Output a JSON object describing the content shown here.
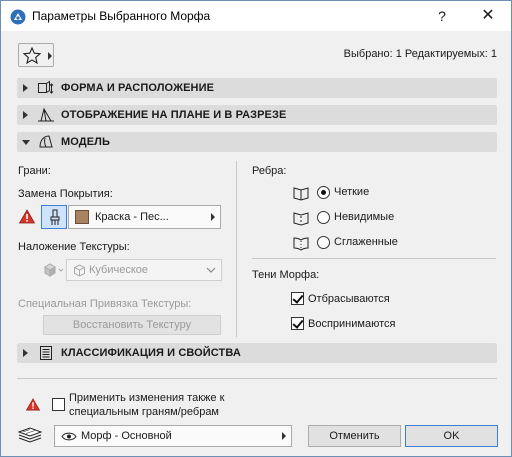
{
  "window": {
    "title": "Параметры Выбранного Морфа",
    "help": "?",
    "close": "✕"
  },
  "toolbar": {
    "selection_info": "Выбрано: 1 Редактируемых: 1"
  },
  "panels": [
    {
      "label": "ФОРМА И РАСПОЛОЖЕНИЕ",
      "expanded": false
    },
    {
      "label": "ОТОБРАЖЕНИЕ НА ПЛАНЕ И В РАЗРЕЗЕ",
      "expanded": false
    },
    {
      "label": "МОДЕЛЬ",
      "expanded": true
    },
    {
      "label": "КЛАССИФИКАЦИЯ И СВОЙСТВА",
      "expanded": false
    }
  ],
  "model": {
    "faces_label": "Грани:",
    "surface_override_label": "Замена Покрытия:",
    "surface_value": "Краска - Пес...",
    "texture_mapping_label": "Наложение Текстуры:",
    "texture_mapping_value": "Кубическое",
    "custom_texture_label": "Специальная Привязка Текстуры:",
    "restore_texture_button": "Восстановить Текстуру",
    "edges_label": "Ребра:",
    "edge_options": [
      {
        "label": "Четкие",
        "selected": true
      },
      {
        "label": "Невидимые",
        "selected": false
      },
      {
        "label": "Сглаженные",
        "selected": false
      }
    ],
    "shadows_label": "Тени Морфа:",
    "shadow_options": [
      {
        "label": "Отбрасываются",
        "checked": true
      },
      {
        "label": "Воспринимаются",
        "checked": true
      }
    ],
    "surface_color": "#a9825f"
  },
  "footer": {
    "apply_special_line1": "Применить изменения также к",
    "apply_special_line2": "специальным граням/ребрам",
    "apply_special_checked": false,
    "layer_value": "Морф - Основной",
    "cancel_label": "Отменить",
    "ok_label": "OK"
  }
}
